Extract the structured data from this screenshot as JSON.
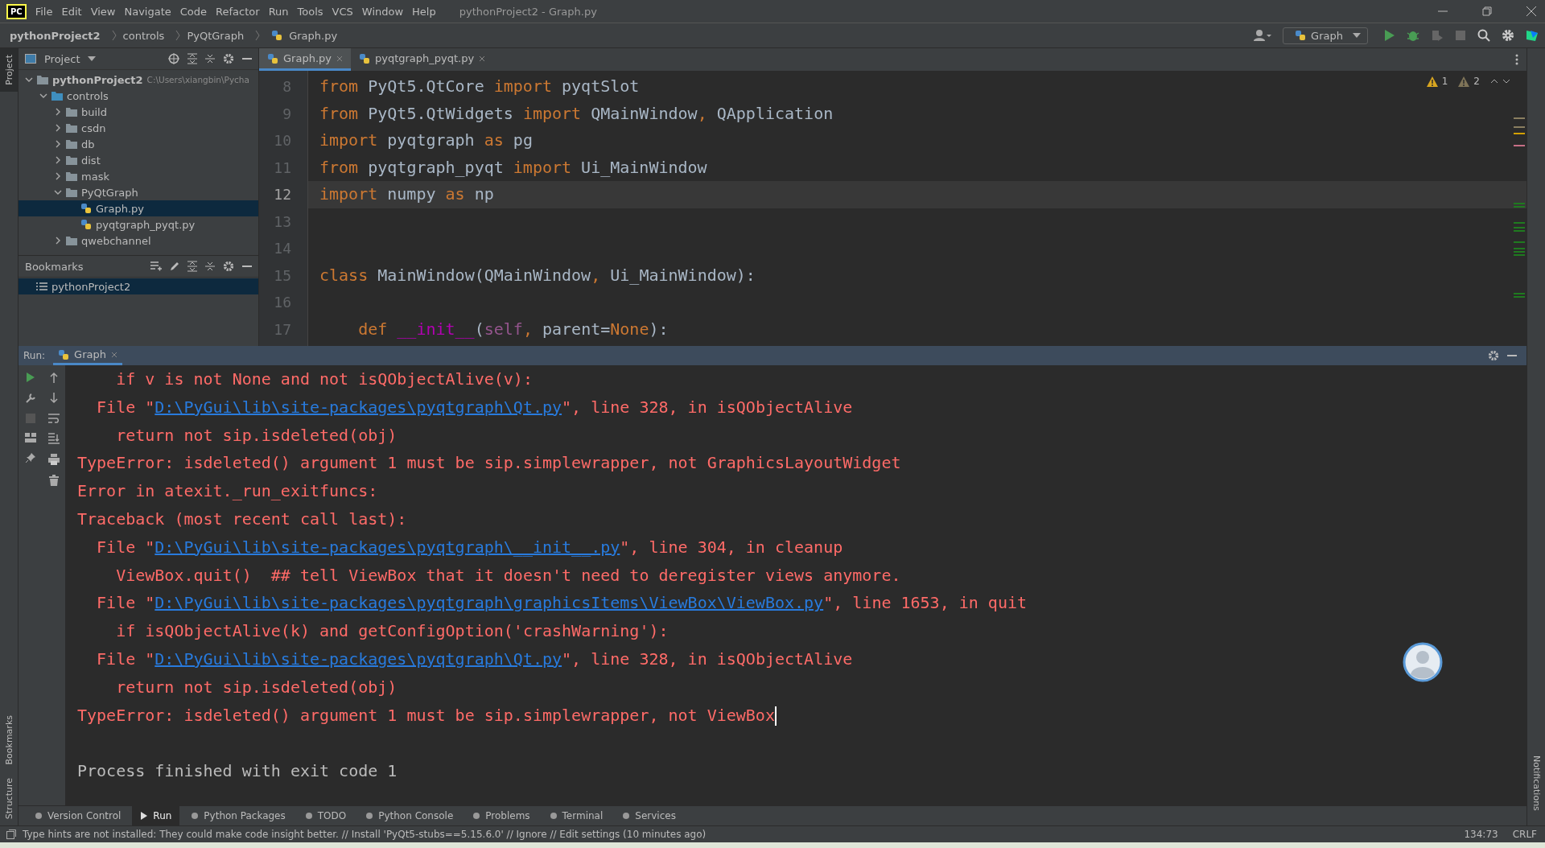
{
  "window": {
    "title": "pythonProject2 - Graph.py",
    "app_logo": "PC"
  },
  "menu": [
    "File",
    "Edit",
    "View",
    "Navigate",
    "Code",
    "Refactor",
    "Run",
    "Tools",
    "VCS",
    "Window",
    "Help"
  ],
  "breadcrumbs": [
    "pythonProject2",
    "controls",
    "PyQtGraph",
    "Graph.py"
  ],
  "run_config": "Graph",
  "left_strip": [
    "Project",
    "Bookmarks",
    "Structure"
  ],
  "right_strip": [
    "Notifications"
  ],
  "project": {
    "title": "Project",
    "tree": [
      {
        "label": "pythonProject2",
        "path": "C:\\Users\\xiangbin\\Pycha",
        "kind": "folder",
        "expanded": true,
        "selected": false,
        "children": [
          {
            "label": "controls",
            "kind": "module",
            "expanded": true,
            "selected": false,
            "children": [
              {
                "label": "build",
                "kind": "folder",
                "expanded": false,
                "selected": false
              },
              {
                "label": "csdn",
                "kind": "folder",
                "expanded": false,
                "selected": false
              },
              {
                "label": "db",
                "kind": "folder",
                "expanded": false,
                "selected": false
              },
              {
                "label": "dist",
                "kind": "folder",
                "expanded": false,
                "selected": false
              },
              {
                "label": "mask",
                "kind": "folder",
                "expanded": false,
                "selected": false
              },
              {
                "label": "PyQtGraph",
                "kind": "folder",
                "expanded": true,
                "selected": false,
                "children": [
                  {
                    "label": "Graph.py",
                    "kind": "python",
                    "selected": true
                  },
                  {
                    "label": "pyqtgraph_pyqt.py",
                    "kind": "python",
                    "selected": false
                  }
                ]
              },
              {
                "label": "qwebchannel",
                "kind": "folder",
                "expanded": false,
                "selected": false
              }
            ]
          }
        ]
      }
    ]
  },
  "bookmarks": {
    "title": "Bookmarks",
    "items": [
      {
        "label": "pythonProject2",
        "selected": true
      }
    ]
  },
  "editor_tabs": [
    {
      "label": "Graph.py",
      "selected": true
    },
    {
      "label": "pyqtgraph_pyqt.py",
      "selected": false
    }
  ],
  "inspections": {
    "warnings": "1",
    "weak_warnings": "2"
  },
  "code": [
    {
      "num": "8",
      "current": false,
      "tokens": [
        {
          "t": "from",
          "kind": "kw"
        },
        {
          "t": " PyQt5.QtCore ",
          "kind": "plain"
        },
        {
          "t": "import",
          "kind": "kw"
        },
        {
          "t": " pyqtSlot",
          "kind": "plain"
        }
      ]
    },
    {
      "num": "9",
      "current": false,
      "tokens": [
        {
          "t": "from",
          "kind": "kw"
        },
        {
          "t": " PyQt5.QtWidgets ",
          "kind": "plain"
        },
        {
          "t": "import",
          "kind": "kw"
        },
        {
          "t": " QMainWindow",
          "kind": "plain"
        },
        {
          "t": ", ",
          "kind": "kw"
        },
        {
          "t": "QApplication",
          "kind": "plain"
        }
      ]
    },
    {
      "num": "10",
      "current": false,
      "tokens": [
        {
          "t": "import",
          "kind": "kw"
        },
        {
          "t": " pyqtgraph ",
          "kind": "plain"
        },
        {
          "t": "as",
          "kind": "kw"
        },
        {
          "t": " pg",
          "kind": "plain"
        }
      ]
    },
    {
      "num": "11",
      "current": false,
      "tokens": [
        {
          "t": "from",
          "kind": "kw"
        },
        {
          "t": " pyqtgraph_pyqt ",
          "kind": "plain"
        },
        {
          "t": "import",
          "kind": "kw"
        },
        {
          "t": " Ui_MainWindow",
          "kind": "plain"
        }
      ]
    },
    {
      "num": "12",
      "current": true,
      "tokens": [
        {
          "t": "import",
          "kind": "kw"
        },
        {
          "t": " numpy ",
          "kind": "plain"
        },
        {
          "t": "as",
          "kind": "kw"
        },
        {
          "t": " np",
          "kind": "plain"
        }
      ]
    },
    {
      "num": "13",
      "current": false
    },
    {
      "num": "14",
      "current": false
    },
    {
      "num": "15",
      "current": false,
      "tokens": [
        {
          "t": "class",
          "kind": "kw"
        },
        {
          "t": " MainWindow(QMainWindow",
          "kind": "plain"
        },
        {
          "t": ", ",
          "kind": "kw"
        },
        {
          "t": "Ui_MainWindow):",
          "kind": "plain"
        }
      ]
    },
    {
      "num": "16",
      "current": false
    },
    {
      "num": "17",
      "current": false,
      "tokens": [
        {
          "t": "    def ",
          "kind": "kw"
        },
        {
          "t": "__init__",
          "kind": "magic"
        },
        {
          "t": "(",
          "kind": "plain"
        },
        {
          "t": "self",
          "kind": "self"
        },
        {
          "t": ", ",
          "kind": "kw"
        },
        {
          "t": "parent=",
          "kind": "plain"
        },
        {
          "t": "None",
          "kind": "kw"
        },
        {
          "t": "):",
          "kind": "plain"
        }
      ]
    }
  ],
  "run": {
    "label": "Run:",
    "tab": "Graph"
  },
  "console": [
    {
      "kind": "error",
      "segs": [
        {
          "t": "    if v is not None and not isQObjectAlive(v):",
          "kind": "text"
        }
      ]
    },
    {
      "kind": "error",
      "segs": [
        {
          "t": "  File \"",
          "kind": "text"
        },
        {
          "t": "D:\\PyGui\\lib\\site-packages\\pyqtgraph\\Qt.py",
          "kind": "link"
        },
        {
          "t": "\", line 328, in isQObjectAlive",
          "kind": "text"
        }
      ]
    },
    {
      "kind": "error",
      "segs": [
        {
          "t": "    return not sip.isdeleted(obj)",
          "kind": "text"
        }
      ]
    },
    {
      "kind": "error",
      "segs": [
        {
          "t": "TypeError: isdeleted() argument 1 must be sip.simplewrapper, not GraphicsLayoutWidget",
          "kind": "text"
        }
      ]
    },
    {
      "kind": "error",
      "segs": [
        {
          "t": "Error in atexit._run_exitfuncs:",
          "kind": "text"
        }
      ]
    },
    {
      "kind": "error",
      "segs": [
        {
          "t": "Traceback (most recent call last):",
          "kind": "text"
        }
      ]
    },
    {
      "kind": "error",
      "segs": [
        {
          "t": "  File \"",
          "kind": "text"
        },
        {
          "t": "D:\\PyGui\\lib\\site-packages\\pyqtgraph\\__init__.py",
          "kind": "link"
        },
        {
          "t": "\", line 304, in cleanup",
          "kind": "text"
        }
      ]
    },
    {
      "kind": "error",
      "segs": [
        {
          "t": "    ViewBox.quit()  ## tell ViewBox that it doesn't need to deregister views anymore.",
          "kind": "text"
        }
      ]
    },
    {
      "kind": "error",
      "segs": [
        {
          "t": "  File \"",
          "kind": "text"
        },
        {
          "t": "D:\\PyGui\\lib\\site-packages\\pyqtgraph\\graphicsItems\\ViewBox\\ViewBox.py",
          "kind": "link"
        },
        {
          "t": "\", line 1653, in quit",
          "kind": "text"
        }
      ]
    },
    {
      "kind": "error",
      "segs": [
        {
          "t": "    if isQObjectAlive(k) and getConfigOption('crashWarning'):",
          "kind": "text"
        }
      ]
    },
    {
      "kind": "error",
      "segs": [
        {
          "t": "  File \"",
          "kind": "text"
        },
        {
          "t": "D:\\PyGui\\lib\\site-packages\\pyqtgraph\\Qt.py",
          "kind": "link"
        },
        {
          "t": "\", line 328, in isQObjectAlive",
          "kind": "text"
        }
      ]
    },
    {
      "kind": "error",
      "segs": [
        {
          "t": "    return not sip.isdeleted(obj)",
          "kind": "text"
        }
      ]
    },
    {
      "kind": "error",
      "cursor": true,
      "segs": [
        {
          "t": "TypeError: isdeleted() argument 1 must be sip.simplewrapper, not ViewBox",
          "kind": "text"
        }
      ]
    },
    {
      "kind": "blank"
    },
    {
      "kind": "info",
      "segs": [
        {
          "t": "Process finished with exit code 1",
          "kind": "text"
        }
      ]
    }
  ],
  "tool_tabs": [
    {
      "label": "Version Control",
      "selected": false
    },
    {
      "label": "Run",
      "selected": true
    },
    {
      "label": "Python Packages",
      "selected": false
    },
    {
      "label": "TODO",
      "selected": false
    },
    {
      "label": "Python Console",
      "selected": false
    },
    {
      "label": "Problems",
      "selected": false
    },
    {
      "label": "Terminal",
      "selected": false
    },
    {
      "label": "Services",
      "selected": false
    }
  ],
  "status_bar": {
    "message": "Type hints are not installed: They could make code insight better. // Install 'PyQt5-stubs==5.15.6.0' // Ignore // Edit settings (10 minutes ago)",
    "position": "134:73",
    "line_separator": "CRLF"
  }
}
